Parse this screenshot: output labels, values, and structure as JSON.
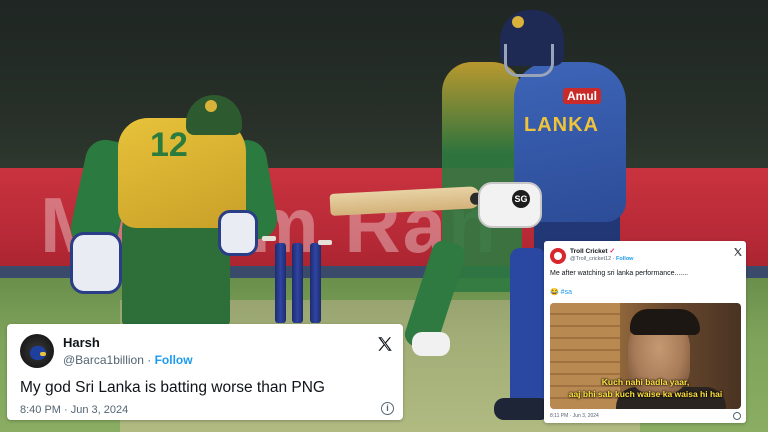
{
  "scene": {
    "keeper_number": "12",
    "batter_jersey_text": "LANKA",
    "sponsor_badge": "Amul",
    "bat_brand": "SG",
    "board_text": "Muslim Ran"
  },
  "tweet_left": {
    "name": "Harsh",
    "handle": "@Barca1billion",
    "separator": "·",
    "follow_label": "Follow",
    "body": "My god Sri Lanka is batting worse than PNG",
    "timestamp": "8:40 PM · Jun 3, 2024",
    "info_symbol": "i",
    "close_icon": "x-logo-icon"
  },
  "tweet_right": {
    "name": "Troll Cricket",
    "verified_mark": "✓",
    "handle": "@Troll_cricket12",
    "separator": "·",
    "follow_label": "Follow",
    "body": "Me  after watching sri lanka performance.......",
    "emoji": "😂",
    "hashtag": "#sa",
    "caption_line1": "Kuch nahi badla yaar,",
    "caption_line2": "aaj bhi sab kuch waise ka waisa hi hai",
    "timestamp": "8:11 PM · Jun 3, 2024",
    "close_icon": "x-logo-icon"
  },
  "colors": {
    "link_blue": "#1d9bf0",
    "text_dark": "#0f1419",
    "text_grey": "#536471",
    "caption_yellow": "#ffe23c",
    "board_red": "#c9333f"
  }
}
